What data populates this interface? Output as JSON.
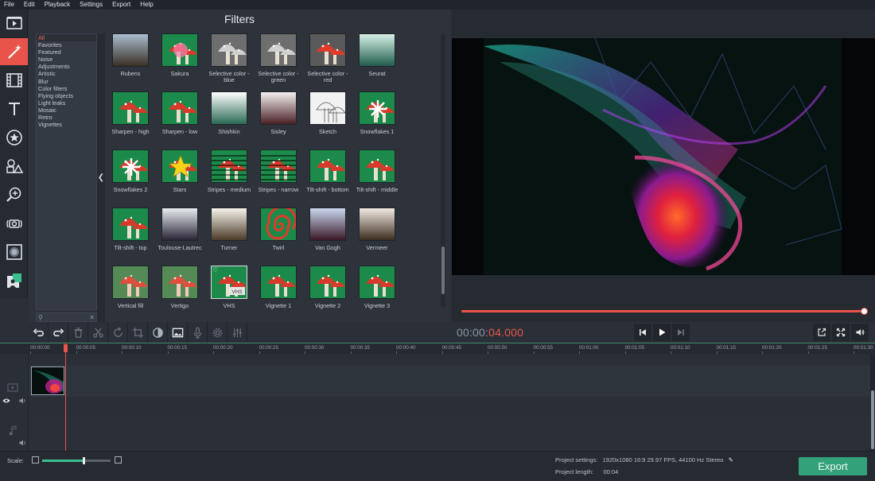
{
  "menu": [
    "File",
    "Edit",
    "Playback",
    "Settings",
    "Export",
    "Help"
  ],
  "left_tools": [
    {
      "name": "import-icon",
      "active": false
    },
    {
      "name": "filters-magic-wand-icon",
      "active": true
    },
    {
      "name": "transitions-film-icon",
      "active": false
    },
    {
      "name": "titles-text-icon",
      "active": false
    },
    {
      "name": "stickers-star-icon",
      "active": false
    },
    {
      "name": "callouts-shapes-icon",
      "active": false
    },
    {
      "name": "zoom-pan-icon",
      "active": false
    },
    {
      "name": "stabilization-camera-icon",
      "active": false
    },
    {
      "name": "mosaic-icon",
      "active": false
    },
    {
      "name": "chroma-key-icon",
      "active": false
    }
  ],
  "filters": {
    "title": "Filters",
    "categories": [
      "All",
      "Favorites",
      "Featured",
      "Noise",
      "Adjustments",
      "Artistic",
      "Blur",
      "Color filters",
      "Flying objects",
      "Light leaks",
      "Mosaic",
      "Retro",
      "Vignettes"
    ],
    "selected_category": "All",
    "tiles": [
      {
        "label": "Rubens",
        "kind": "grad",
        "c1": "#a9bed0",
        "c2": "#3a2f24"
      },
      {
        "label": "Sakura",
        "kind": "mushroom",
        "accent": "#ff7fb0"
      },
      {
        "label": "Selective color - blue",
        "kind": "mushroom-gray"
      },
      {
        "label": "Selective color - green",
        "kind": "mushroom-gray"
      },
      {
        "label": "Selective color - red",
        "kind": "mushroom-red"
      },
      {
        "label": "Seurat",
        "kind": "grad",
        "c1": "#d7f0e6",
        "c2": "#1f5d4c"
      },
      {
        "label": "Sharpen - high",
        "kind": "mushroom"
      },
      {
        "label": "Sharpen - low",
        "kind": "mushroom"
      },
      {
        "label": "Shishkin",
        "kind": "grad",
        "c1": "#ffffff",
        "c2": "#2a6a55"
      },
      {
        "label": "Sisley",
        "kind": "grad",
        "c1": "#f4f1f0",
        "c2": "#4a1f24"
      },
      {
        "label": "Sketch",
        "kind": "sketch"
      },
      {
        "label": "Snowflakes 1",
        "kind": "mushroom-snow"
      },
      {
        "label": "Snowflakes 2",
        "kind": "mushroom-snow"
      },
      {
        "label": "Stars",
        "kind": "mushroom-star"
      },
      {
        "label": "Stripes - medium",
        "kind": "mushroom-stripes"
      },
      {
        "label": "Stripes - narrow",
        "kind": "mushroom-stripes"
      },
      {
        "label": "Tilt-shift - bottom",
        "kind": "mushroom"
      },
      {
        "label": "Tilt-shift - middle",
        "kind": "mushroom"
      },
      {
        "label": "Tilt-shift - top",
        "kind": "mushroom"
      },
      {
        "label": "Toulouse-Lautrec",
        "kind": "grad",
        "c1": "#e8eef2",
        "c2": "#2a2334"
      },
      {
        "label": "Turner",
        "kind": "grad",
        "c1": "#f7f4ec",
        "c2": "#4b3a28"
      },
      {
        "label": "Twirl",
        "kind": "twirl"
      },
      {
        "label": "Van Gogh",
        "kind": "grad",
        "c1": "#c9d8f0",
        "c2": "#3a1826"
      },
      {
        "label": "Vermeer",
        "kind": "grad",
        "c1": "#f3ece2",
        "c2": "#3c2d20"
      },
      {
        "label": "Vertical fill",
        "kind": "mushroom-blur"
      },
      {
        "label": "Vertigo",
        "kind": "mushroom-blur"
      },
      {
        "label": "VHS",
        "kind": "mushroom-vhs",
        "badge": "VHS"
      },
      {
        "label": "Vignette 1",
        "kind": "mushroom"
      },
      {
        "label": "Vignette 2",
        "kind": "mushroom"
      },
      {
        "label": "Vignette 3",
        "kind": "mushroom"
      }
    ]
  },
  "transport": {
    "timecode_gray": "00:00:",
    "timecode_red": "04.000",
    "progress": 1.0
  },
  "timeline": {
    "ticks": [
      "00:00:00",
      "00:00:05",
      "00:00:10",
      "00:00:15",
      "00:00:20",
      "00:00:25",
      "00:00:30",
      "00:00:35",
      "00:00:40",
      "00:00:45",
      "00:00:50",
      "00:00:55",
      "00:01:00",
      "00:01:05",
      "00:01:10",
      "00:01:15",
      "00:01:20",
      "00:01:25",
      "00:01:30"
    ]
  },
  "bottom": {
    "scale_label": "Scale:",
    "scale_level": 0.6,
    "project_settings_label": "Project settings:",
    "project_settings_value": "1920x1080 16:9 29.97 FPS, 44100 Hz Stereo",
    "project_length_label": "Project length:",
    "project_length_value": "00:04",
    "export_label": "Export"
  },
  "colors": {
    "accent": "#e8544a",
    "export": "#33a27a",
    "green": "#3bbf8e"
  }
}
